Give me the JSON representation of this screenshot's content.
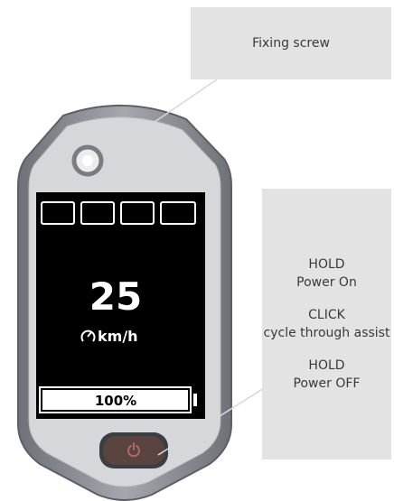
{
  "callouts": {
    "fixing_screw": "Fixing screw",
    "button_instructions": [
      {
        "action": "HOLD",
        "result": "Power On"
      },
      {
        "action": "CLICK",
        "result": "cycle through assist"
      },
      {
        "action": "HOLD",
        "result": "Power OFF"
      }
    ]
  },
  "display": {
    "speed": "25",
    "speed_unit": "km/h",
    "battery_percent": "100%",
    "battery_level": 1.0,
    "assist_level_boxes": 4
  },
  "colors": {
    "callout_background": "#e3e3e3",
    "screen": "#000000",
    "bezel": "#8d8f96",
    "power_button": "#5a4440"
  },
  "icons": [
    "power-icon",
    "speedometer-icon"
  ]
}
